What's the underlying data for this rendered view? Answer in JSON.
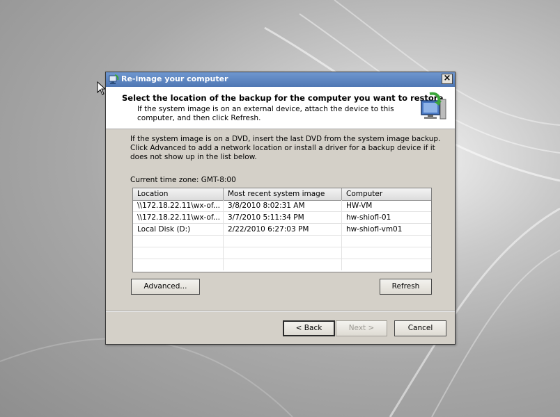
{
  "dialog": {
    "title": "Re-image your computer",
    "close_label": "×",
    "header_title": "Select the location of the backup for the computer you want to restore",
    "header_subtitle": "If the system image is on an external device, attach the device to this computer, and then click Refresh.",
    "body_text": "If the system image is on a DVD, insert the last DVD from the system image backup. Click Advanced to add a network location or install a driver for a backup device if it does not show up in the list below.",
    "timezone": "Current time zone: GMT-8:00"
  },
  "table": {
    "columns": [
      "Location",
      "Most recent system image",
      "Computer"
    ],
    "rows": [
      {
        "location": "\\\\172.18.22.11\\wx-of...",
        "image": "3/8/2010 8:02:31 AM",
        "computer": "HW-VM"
      },
      {
        "location": "\\\\172.18.22.11\\wx-of...",
        "image": "3/7/2010 5:11:34 PM",
        "computer": "hw-shiofl-01"
      },
      {
        "location": "Local Disk (D:)",
        "image": "2/22/2010 6:27:03 PM",
        "computer": "hw-shiofl-vm01"
      }
    ]
  },
  "buttons": {
    "advanced": "Advanced...",
    "refresh": "Refresh",
    "back": "< Back",
    "next": "Next >",
    "cancel": "Cancel"
  },
  "icons": {
    "title": "reimage-computer-icon",
    "header": "restore-computer-icon",
    "cursor": "mouse-pointer-icon"
  }
}
